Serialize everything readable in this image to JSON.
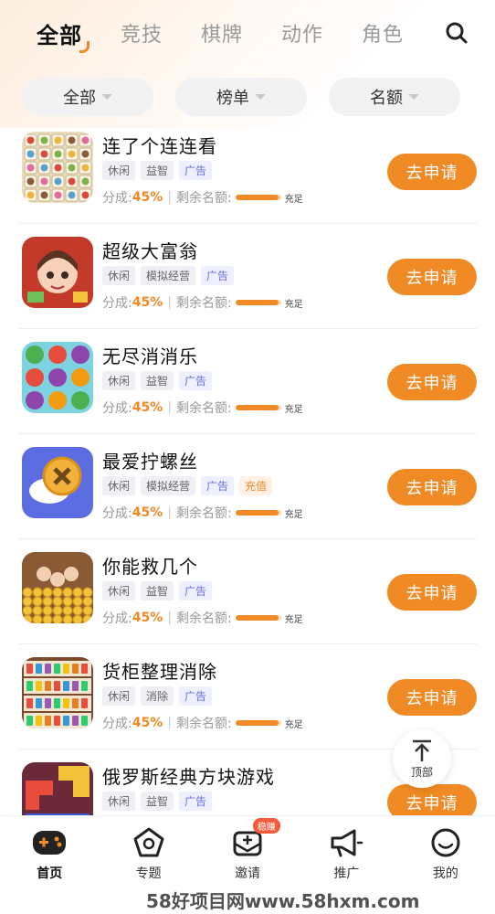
{
  "category_tabs": [
    {
      "label": "全部",
      "active": true
    },
    {
      "label": "竞技",
      "active": false
    },
    {
      "label": "棋牌",
      "active": false
    },
    {
      "label": "动作",
      "active": false
    },
    {
      "label": "角色",
      "active": false
    }
  ],
  "filters": [
    {
      "label": "全部"
    },
    {
      "label": "榜单"
    },
    {
      "label": "名额"
    }
  ],
  "stats_labels": {
    "share_prefix": "分成:",
    "quota_prefix": "剩余名额:",
    "quota_status": "充足"
  },
  "apply_label": "去申请",
  "games": [
    {
      "title": "连了个连连看",
      "tags": [
        "休闲",
        "益智"
      ],
      "ad_tag": "广告",
      "pay_tag": "",
      "share": "45%",
      "quota_level": 0.95
    },
    {
      "title": "超级大富翁",
      "tags": [
        "休闲",
        "模拟经营"
      ],
      "ad_tag": "广告",
      "pay_tag": "",
      "share": "45%",
      "quota_level": 0.95
    },
    {
      "title": "无尽消消乐",
      "tags": [
        "休闲",
        "益智"
      ],
      "ad_tag": "广告",
      "pay_tag": "",
      "share": "45%",
      "quota_level": 0.95
    },
    {
      "title": "最爱拧螺丝",
      "tags": [
        "休闲",
        "模拟经营"
      ],
      "ad_tag": "广告",
      "pay_tag": "充值",
      "share": "45%",
      "quota_level": 0.95
    },
    {
      "title": "你能救几个",
      "tags": [
        "休闲",
        "益智"
      ],
      "ad_tag": "广告",
      "pay_tag": "",
      "share": "45%",
      "quota_level": 0.95
    },
    {
      "title": "货柜整理消除",
      "tags": [
        "休闲",
        "消除"
      ],
      "ad_tag": "广告",
      "pay_tag": "",
      "share": "45%",
      "quota_level": 0.95
    },
    {
      "title": "俄罗斯经典方块游戏",
      "tags": [
        "休闲",
        "益智"
      ],
      "ad_tag": "广告",
      "pay_tag": "",
      "share": "",
      "quota_level": 0.95
    }
  ],
  "back_to_top": "顶部",
  "bottom_nav": [
    {
      "label": "首页",
      "icon": "gamepad-icon",
      "active": true,
      "badge": ""
    },
    {
      "label": "专题",
      "icon": "pentagon-icon",
      "active": false,
      "badge": ""
    },
    {
      "label": "邀请",
      "icon": "invite-icon",
      "active": false,
      "badge": "稳赚"
    },
    {
      "label": "推广",
      "icon": "megaphone-icon",
      "active": false,
      "badge": ""
    },
    {
      "label": "我的",
      "icon": "smile-icon",
      "active": false,
      "badge": ""
    }
  ],
  "watermark": "58好项目网www.58hxm.com",
  "colors": {
    "accent": "#f08a24",
    "ad_tag": "#6b6fd6",
    "badge": "#f35b3b"
  }
}
